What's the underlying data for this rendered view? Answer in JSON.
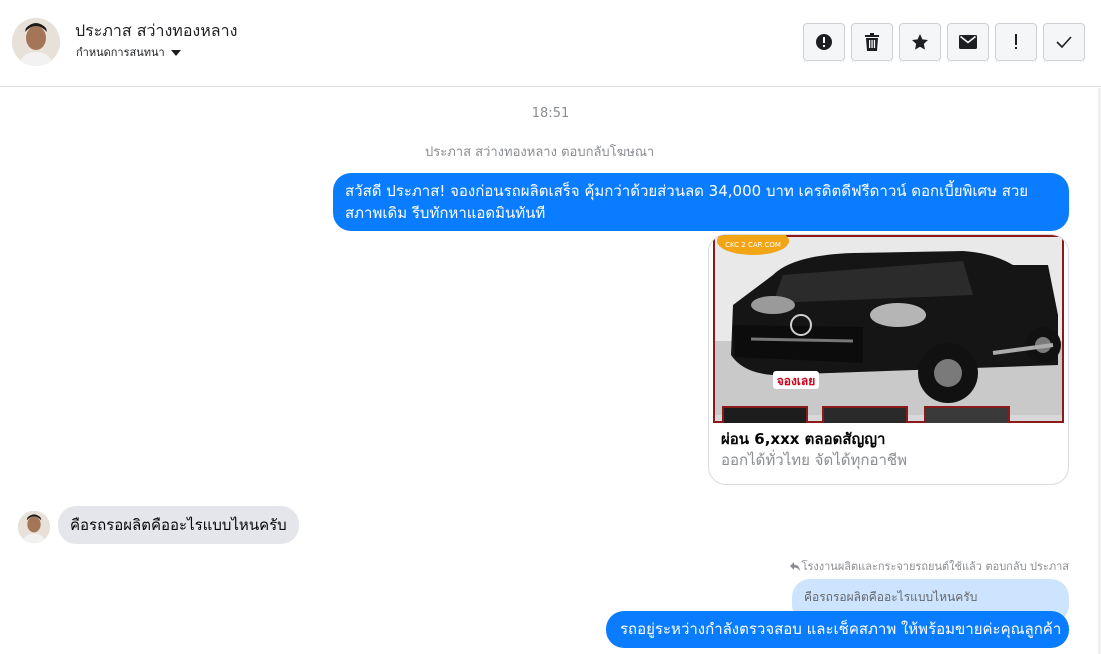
{
  "header": {
    "contact_name": "ประภาส สว่างทองหลาง",
    "conversation_settings": "กำหนดการสนทนา",
    "toolbar": [
      {
        "name": "report-button",
        "icon": "alert-circle-icon"
      },
      {
        "name": "delete-button",
        "icon": "trash-icon"
      },
      {
        "name": "star-button",
        "icon": "star-icon"
      },
      {
        "name": "mark-unread-button",
        "icon": "envelope-icon"
      },
      {
        "name": "important-button",
        "icon": "exclamation-icon"
      },
      {
        "name": "done-button",
        "icon": "checkmark-icon"
      }
    ]
  },
  "thread": {
    "timestamp": "18:51",
    "system_note": "ประภาส สว่างทองหลาง ตอบกลับโฆษณา",
    "messages": {
      "ad_message": "สวัสดี ประภาส! จองก่อนรถผลิตเสร็จ คุ้มกว่าด้วยส่วนลด 34,000 บาท เครดิตดีฟรีดาวน์ ดอกเบี้ยพิเศษ สวยสภาพเดิม รีบทักหาแอดมินทันที",
      "card": {
        "logo_text": "CKC 2 CAR.COM",
        "sticker_text": "จองเลย",
        "title": "ผ่อน 6,xxx ตลอดสัญญา",
        "subtitle": "ออกได้ทั่วไทย จัดได้ทุกอาชีพ"
      },
      "incoming": "คือรถรอผลิตคืออะไรแบบไหนครับ",
      "reply_note": "โรงงานผลิตและกระจายรถยนต์ใช้แล้ว ตอบกลับ ประภาส",
      "quoted": "คือรถรอผลิตคืออะไรแบบไหนครับ",
      "reply": "รถอยู่ระหว่างกำลังตรวจสอบ และเช็คสภาพ ให้พร้อมขายค่ะคุณลูกค้า"
    }
  },
  "colors": {
    "outgoing_bubble": "#0a7cff",
    "incoming_bubble": "#e4e6eb",
    "quoted_bubble": "#cde4ff"
  }
}
